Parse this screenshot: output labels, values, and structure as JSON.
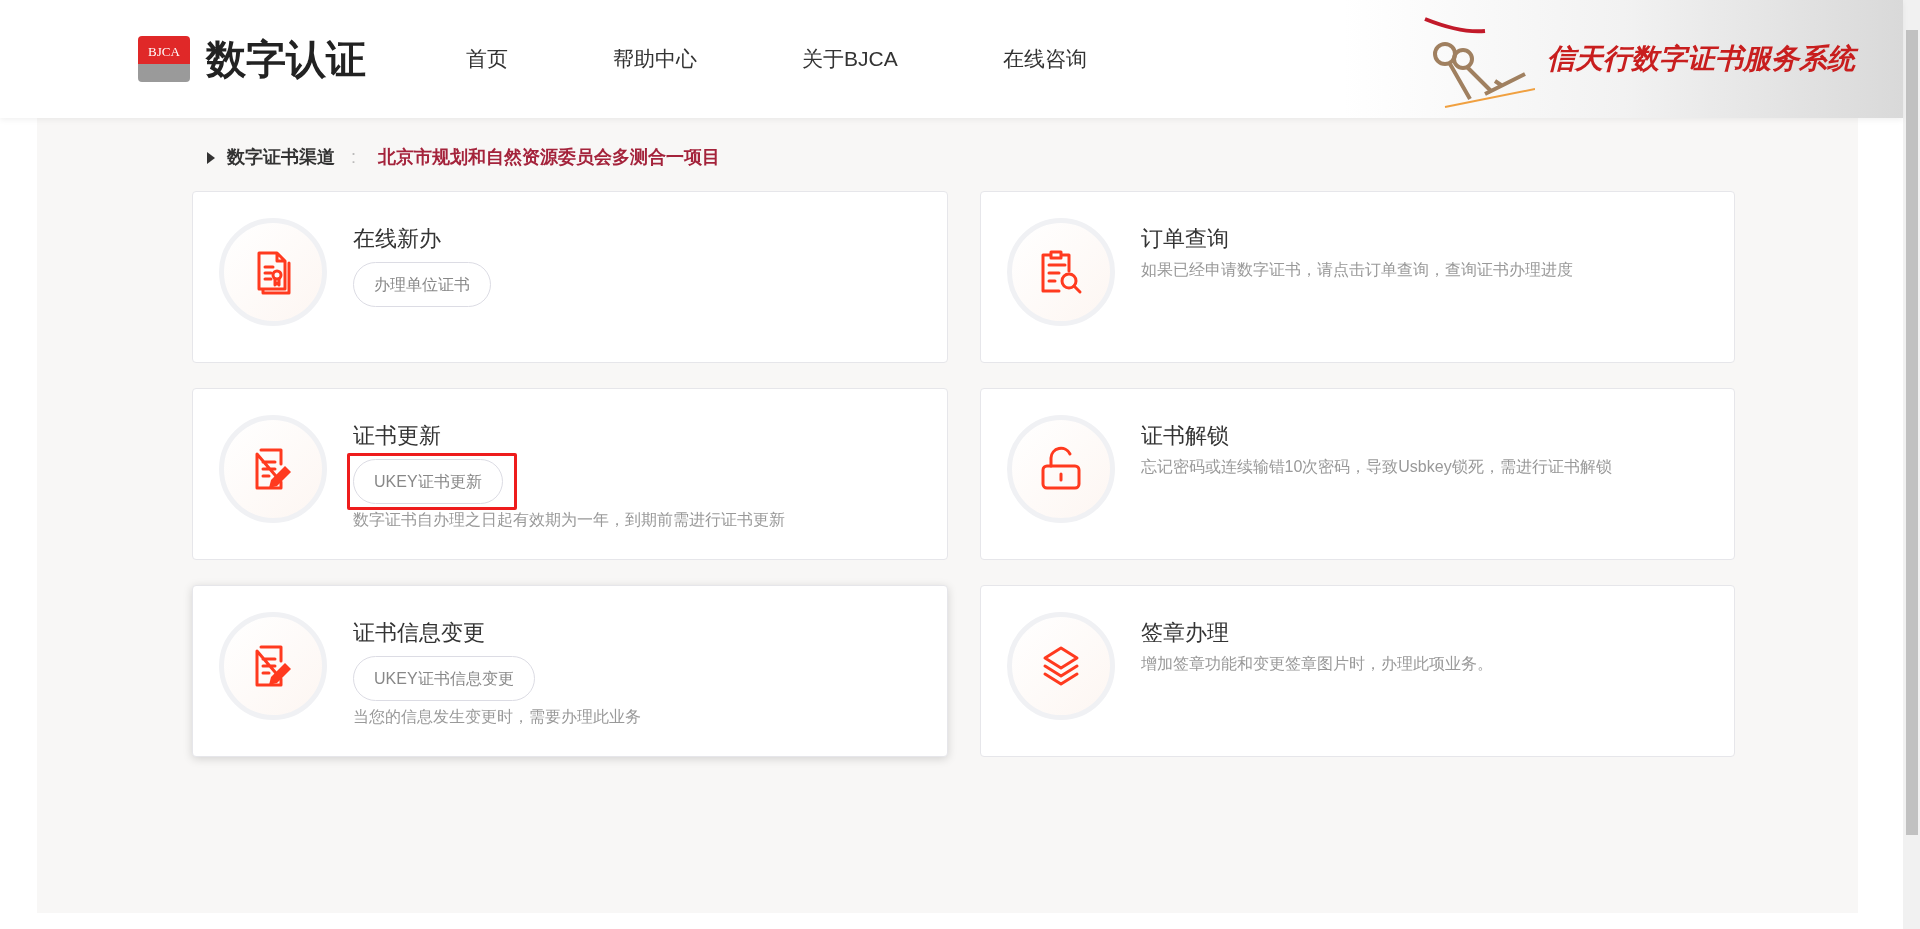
{
  "header": {
    "logo_mark": "BJCA",
    "logo_text": "数字认证",
    "nav": [
      {
        "label": "首页"
      },
      {
        "label": "帮助中心"
      },
      {
        "label": "关于BJCA"
      },
      {
        "label": "在线咨询"
      }
    ],
    "banner_title": "信天行数字证书服务系统"
  },
  "breadcrumb": {
    "label": "数字证书渠道",
    "separator": ":",
    "value": "北京市规划和自然资源委员会多测合一项目"
  },
  "cards": [
    {
      "kind": "new",
      "title": "在线新办",
      "button": "办理单位证书",
      "button_highlighted": false,
      "hover": false
    },
    {
      "kind": "query",
      "title": "订单查询",
      "description": "如果已经申请数字证书，请点击订单查询，查询证书办理进度",
      "hover": false
    },
    {
      "kind": "renew",
      "title": "证书更新",
      "button": "UKEY证书更新",
      "button_highlighted": true,
      "description": "数字证书自办理之日起有效期为一年，到期前需进行证书更新",
      "hover": false
    },
    {
      "kind": "unlock",
      "title": "证书解锁",
      "description": "忘记密码或连续输错10次密码，导致Usbkey锁死，需进行证书解锁",
      "hover": false
    },
    {
      "kind": "change",
      "title": "证书信息变更",
      "button": "UKEY证书信息变更",
      "button_highlighted": false,
      "description": "当您的信息发生变更时，需要办理此业务",
      "hover": true
    },
    {
      "kind": "seal",
      "title": "签章办理",
      "description": "增加签章功能和变更签章图片时，办理此项业务。",
      "hover": false
    }
  ]
}
